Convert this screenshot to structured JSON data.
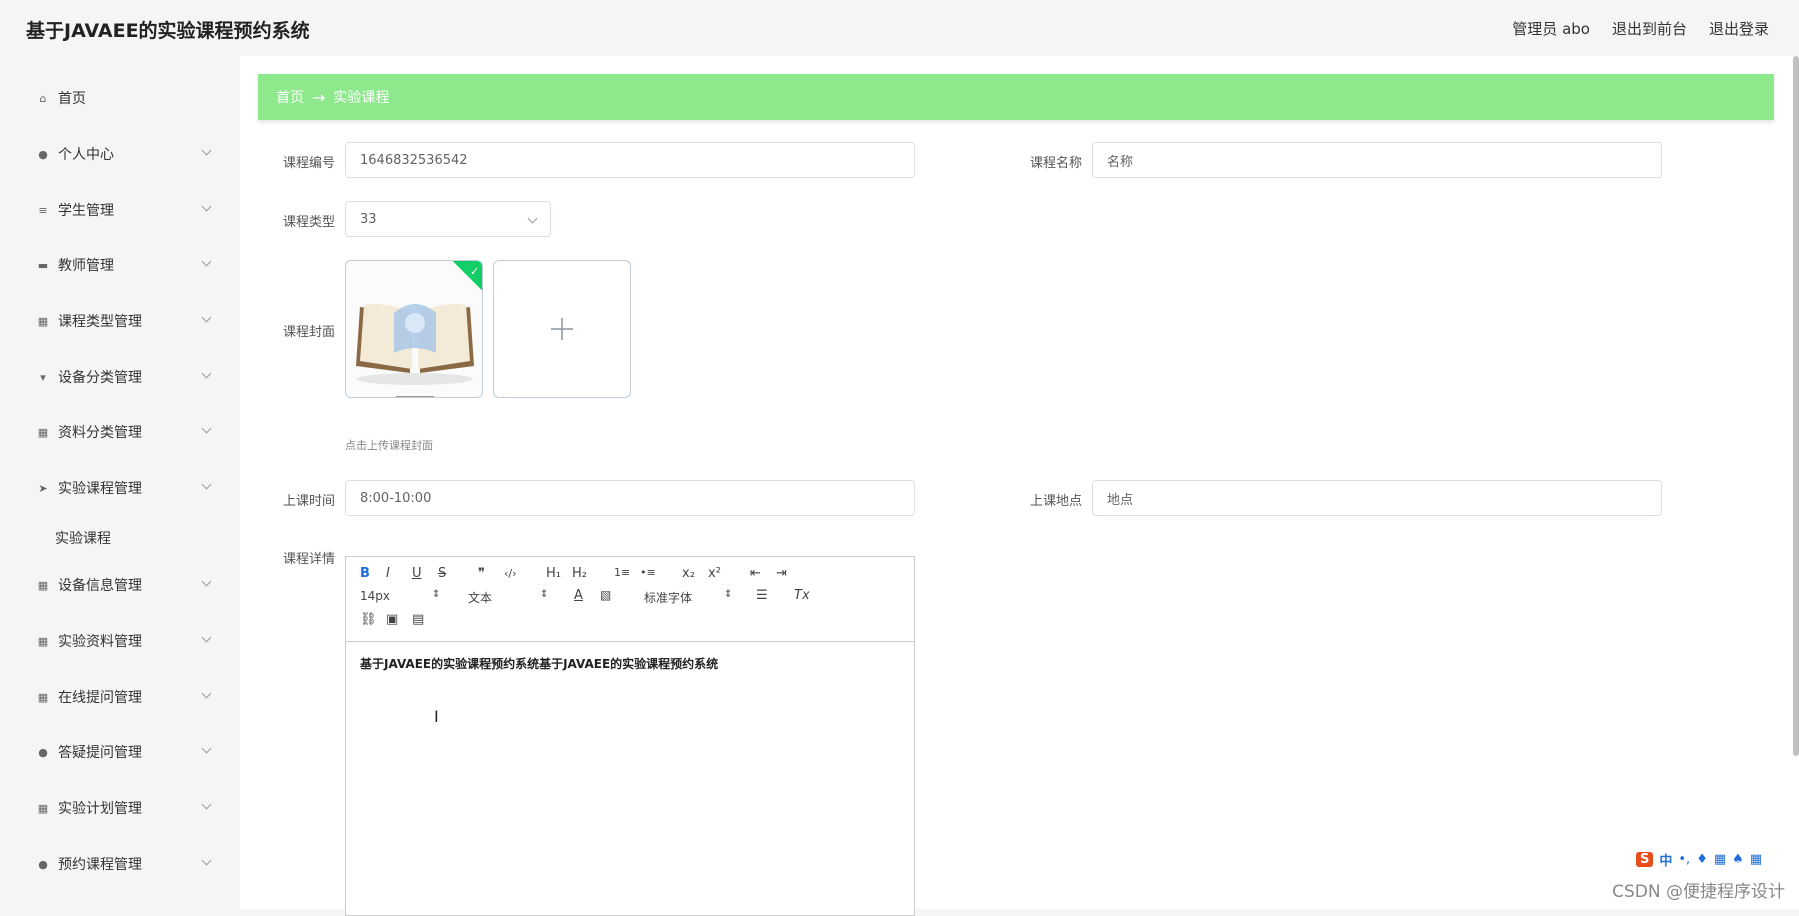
{
  "header": {
    "title": "基于JAVAEE的实验课程预约系统",
    "user": "管理员 abo",
    "to_front": "退出到前台",
    "logout": "退出登录"
  },
  "sidebar": {
    "items": [
      {
        "label": "首页",
        "icon": "home-icon",
        "has_children": false
      },
      {
        "label": "个人中心",
        "icon": "user-icon",
        "has_children": true
      },
      {
        "label": "学生管理",
        "icon": "list-icon",
        "has_children": true
      },
      {
        "label": "教师管理",
        "icon": "monitor-icon",
        "has_children": true
      },
      {
        "label": "课程类型管理",
        "icon": "grid-icon",
        "has_children": true
      },
      {
        "label": "设备分类管理",
        "icon": "tag-icon",
        "has_children": true
      },
      {
        "label": "资料分类管理",
        "icon": "grid-icon",
        "has_children": true
      },
      {
        "label": "实验课程管理",
        "icon": "send-icon",
        "has_children": true
      },
      {
        "label": "设备信息管理",
        "icon": "grid-icon",
        "has_children": true
      },
      {
        "label": "实验资料管理",
        "icon": "apps-icon",
        "has_children": true
      },
      {
        "label": "在线提问管理",
        "icon": "grid-icon",
        "has_children": true
      },
      {
        "label": "答疑提问管理",
        "icon": "person-icon",
        "has_children": true
      },
      {
        "label": "实验计划管理",
        "icon": "grid-icon",
        "has_children": true
      },
      {
        "label": "预约课程管理",
        "icon": "user-icon",
        "has_children": true
      }
    ],
    "sub_item": "实验课程"
  },
  "breadcrumb": {
    "home": "首页",
    "separator": "→",
    "current": "实验课程"
  },
  "form": {
    "course_no_label": "课程编号",
    "course_no_value": "1646832536542",
    "course_name_label": "课程名称",
    "course_name_placeholder": "名称",
    "course_type_label": "课程类型",
    "course_type_value": "33",
    "cover_label": "课程封面",
    "upload_hint": "点击上传课程封面",
    "time_label": "上课时间",
    "time_value": "8:00-10:00",
    "place_label": "上课地点",
    "place_placeholder": "地点",
    "detail_label": "课程详情"
  },
  "editor": {
    "toolbar_row1": [
      "B",
      "I",
      "U",
      "S",
      "❞",
      "‹/›",
      "H₁",
      "H₂",
      "1≡",
      "•≡",
      "x₂",
      "x²",
      "⇤",
      "⇥"
    ],
    "font_size": "14px",
    "text_type": "文本",
    "font_family": "标准字体",
    "content": "基于JAVAEE的实验课程预约系统基于JAVAEE的实验课程预约系统"
  },
  "ime": {
    "lang": "中"
  },
  "watermark": "CSDN @便捷程序设计",
  "colors": {
    "breadcrumb_bg": "#8de98c",
    "success": "#13ce66",
    "accent": "#409eff"
  }
}
